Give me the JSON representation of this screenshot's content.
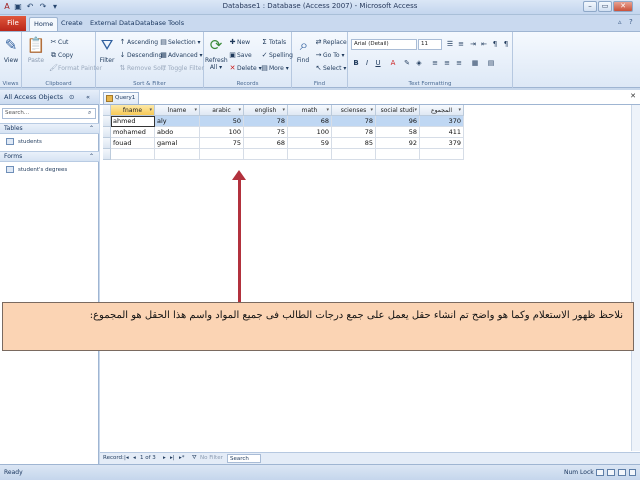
{
  "window": {
    "title": "Database1 : Database (Access 2007)  -  Microsoft Access"
  },
  "title_controls": {
    "minimize": "–",
    "restore": "▭",
    "close": "✕"
  },
  "tabs": {
    "file": "File",
    "home": "Home",
    "create": "Create",
    "external": "External Data",
    "dbtools": "Database Tools"
  },
  "ribbon": {
    "views": {
      "view": "View",
      "group": "Views"
    },
    "clipboard": {
      "paste": "Paste",
      "cut": "Cut",
      "copy": "Copy",
      "format_painter": "Format Painter",
      "group": "Clipboard"
    },
    "sort": {
      "filter": "Filter",
      "ascending": "Ascending",
      "descending": "Descending",
      "remove_sort": "Remove Sort",
      "selection": "Selection ▾",
      "advanced": "Advanced ▾",
      "toggle_filter": "Toggle Filter",
      "group": "Sort & Filter"
    },
    "records": {
      "refresh": "Refresh All ▾",
      "new": "New",
      "save": "Save",
      "delete": "Delete ▾",
      "totals": "Totals",
      "spelling": "Spelling",
      "more": "More ▾",
      "group": "Records"
    },
    "find": {
      "find": "Find",
      "replace": "Replace",
      "goto": "Go To ▾",
      "select": "Select ▾",
      "group": "Find"
    },
    "text": {
      "font": "Arial (Detail)",
      "size": "11",
      "group": "Text Formatting"
    }
  },
  "nav": {
    "title": "All Access Objects",
    "search_placeholder": "Search...",
    "groups": [
      {
        "label": "Tables",
        "items": [
          "students"
        ]
      },
      {
        "label": "Forms",
        "items": [
          "student's degrees"
        ]
      }
    ]
  },
  "doc": {
    "tab_label": "Query1"
  },
  "grid": {
    "columns": [
      "fname",
      "lname",
      "arabic",
      "english",
      "math",
      "scienses",
      "social studi",
      "المجموع"
    ],
    "rows": [
      [
        "ahmed",
        "aly",
        "50",
        "78",
        "68",
        "78",
        "96",
        "370"
      ],
      [
        "mohamed",
        "abdo",
        "100",
        "75",
        "100",
        "78",
        "58",
        "411"
      ],
      [
        "fouad",
        "gamal",
        "75",
        "68",
        "59",
        "85",
        "92",
        "379"
      ]
    ]
  },
  "record_nav": {
    "label": "Record:",
    "position": "1 of 3",
    "filter": "No Filter",
    "search": "Search"
  },
  "annotation": "نلاحظ ظهور الاستعلام وكما هو واضح تم انشاء حقل يعمل على جمع درجات الطالب فى جميع المواد واسم هذا الحقل هو المجموع:",
  "status": {
    "left": "Ready",
    "right": "Num Lock"
  },
  "colors": {
    "accent": "#b2313d",
    "callout_bg": "#fbd4b4",
    "file_tab": "#c9321f"
  }
}
